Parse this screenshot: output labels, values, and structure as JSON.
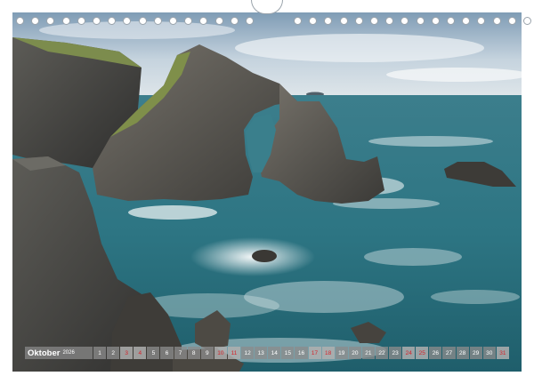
{
  "calendar": {
    "month": "Oktober",
    "year": "2026",
    "days": [
      {
        "n": "1"
      },
      {
        "n": "2"
      },
      {
        "n": "3",
        "sun": true
      },
      {
        "n": "4",
        "sun": true
      },
      {
        "n": "5"
      },
      {
        "n": "6"
      },
      {
        "n": "7"
      },
      {
        "n": "8"
      },
      {
        "n": "9"
      },
      {
        "n": "10",
        "sun": true
      },
      {
        "n": "11",
        "sun": true
      },
      {
        "n": "12"
      },
      {
        "n": "13"
      },
      {
        "n": "14"
      },
      {
        "n": "15"
      },
      {
        "n": "16"
      },
      {
        "n": "17",
        "sun": true
      },
      {
        "n": "18",
        "sun": true
      },
      {
        "n": "19"
      },
      {
        "n": "20"
      },
      {
        "n": "21"
      },
      {
        "n": "22"
      },
      {
        "n": "23"
      },
      {
        "n": "24",
        "sun": true
      },
      {
        "n": "25",
        "sun": true
      },
      {
        "n": "26"
      },
      {
        "n": "27"
      },
      {
        "n": "28"
      },
      {
        "n": "29"
      },
      {
        "n": "30"
      },
      {
        "n": "31",
        "sun": true
      }
    ],
    "holiday_color": "#d6232a"
  },
  "binding": {
    "hole_count": 32
  },
  "photo": {
    "subject-icon": "coastal-sea-arch-icon",
    "palette": {
      "sky": "#c9d6df",
      "sea": "#2e7f8c",
      "foam": "#e6eef0",
      "rock": "#4a4a48",
      "grass": "#7e8f4e"
    }
  }
}
